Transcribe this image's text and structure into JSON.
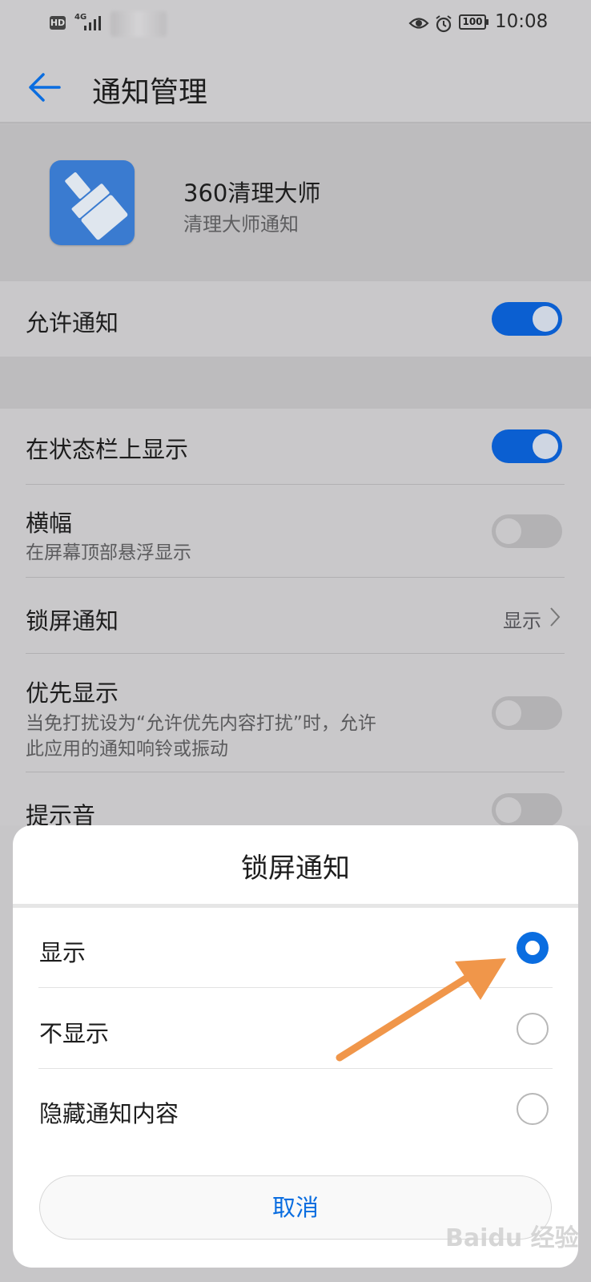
{
  "status_bar": {
    "hd": "HD",
    "network": "4G",
    "battery": "100",
    "time": "10:08",
    "icons": [
      "hd-icon",
      "signal-icon",
      "wifi-icon",
      "eye-icon",
      "alarm-icon",
      "battery-icon"
    ]
  },
  "header": {
    "title": "通知管理",
    "back_icon": "back-arrow-icon"
  },
  "app": {
    "name": "360清理大师",
    "subtitle": "清理大师通知",
    "icon": "broom-app-icon",
    "icon_color": "#3a7bd0"
  },
  "settings": {
    "allow": {
      "label": "允许通知",
      "on": true
    },
    "status_bar": {
      "label": "在状态栏上显示",
      "on": true
    },
    "banner": {
      "label": "横幅",
      "sub": "在屏幕顶部悬浮显示",
      "on": false
    },
    "lock_screen": {
      "label": "锁屏通知",
      "value": "显示"
    },
    "priority": {
      "label": "优先显示",
      "sub_line1": "当免打扰设为“允许优先内容打扰”时，允许",
      "sub_line2": "此应用的通知响铃或振动",
      "on": false
    },
    "sound": {
      "label": "提示音",
      "on": false
    }
  },
  "dialog": {
    "title": "锁屏通知",
    "options": [
      {
        "label": "显示",
        "selected": true
      },
      {
        "label": "不显示",
        "selected": false
      },
      {
        "label": "隐藏通知内容",
        "selected": false
      }
    ],
    "cancel_label": "取消"
  },
  "colors": {
    "accent": "#0a6de0",
    "toggle_on": "#0b5fd1",
    "annotation_arrow": "#f0964a"
  },
  "watermark": "Baidu 经验"
}
